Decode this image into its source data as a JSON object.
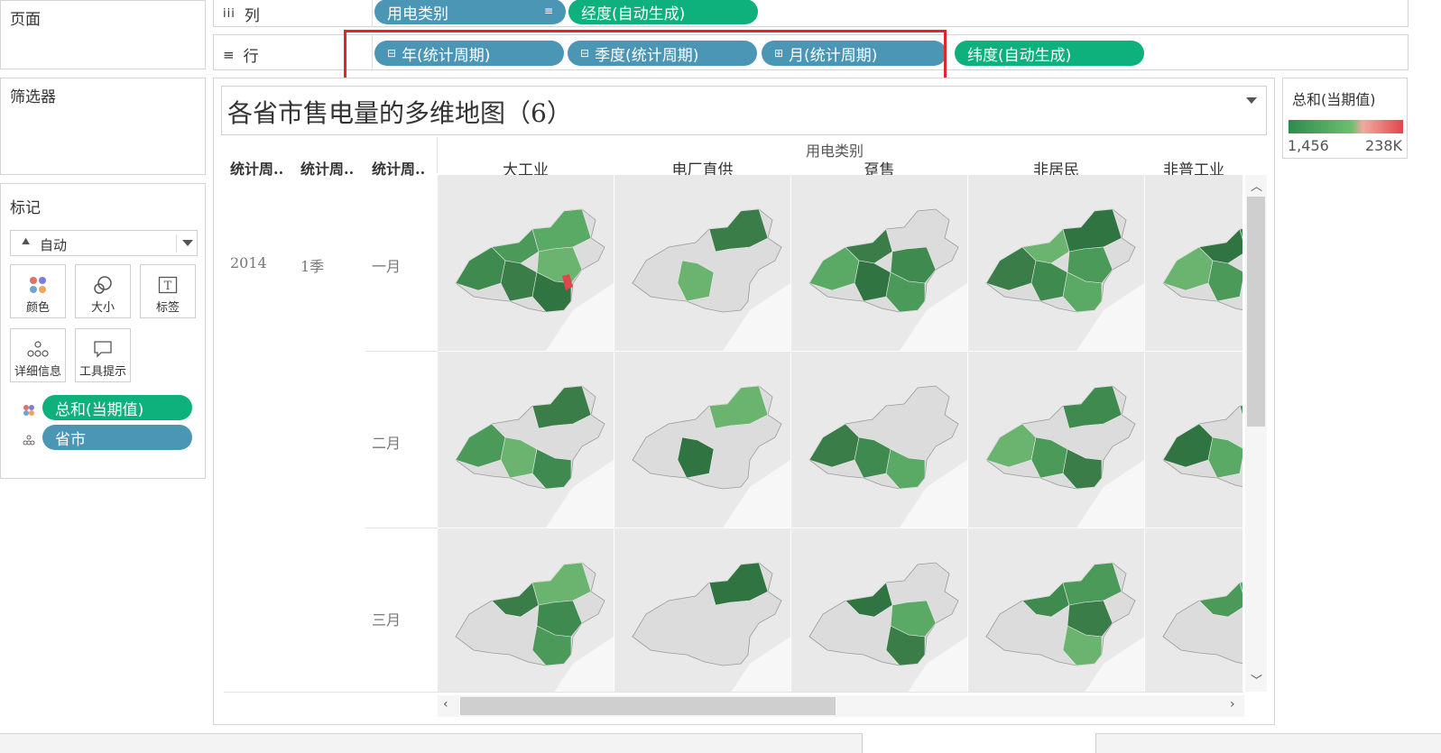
{
  "pages_title": "页面",
  "filters_title": "筛选器",
  "marks": {
    "title": "标记",
    "type_label": "自动",
    "buttons": {
      "color": "颜色",
      "size": "大小",
      "label": "标签",
      "detail": "详细信息",
      "tooltip": "工具提示"
    },
    "pill_color": "总和(当期值)",
    "pill_detail": "省市"
  },
  "columns_shelf": {
    "label": "列",
    "pills": [
      "用电类别",
      "经度(自动生成)"
    ]
  },
  "rows_shelf": {
    "label": "行",
    "pills": [
      "年(统计周期)",
      "季度(统计周期)",
      "月(统计周期)",
      "纬度(自动生成)"
    ],
    "prefixes": [
      "⊟",
      "⊟",
      "⊞"
    ]
  },
  "view": {
    "title": "各省市售电量的多维地图（6）",
    "column_group_header": "用电类别",
    "row_headers": [
      "统计周..",
      "统计周..",
      "统计周.."
    ],
    "categories": [
      "大工业",
      "电厂直供",
      "趸售",
      "非居民",
      "非普工业"
    ],
    "year": "2014",
    "quarter": "1季",
    "months": [
      "一月",
      "二月",
      "三月"
    ]
  },
  "legend": {
    "title": "总和(当期值)",
    "min_label": "1,456",
    "max_label": "238K",
    "color_low": "#2e8b4e",
    "color_high": "#e0474c"
  },
  "colors": {
    "blue_pill": "#4b96b4",
    "green_pill": "#0eb07c",
    "highlight_box": "#e0262b"
  }
}
